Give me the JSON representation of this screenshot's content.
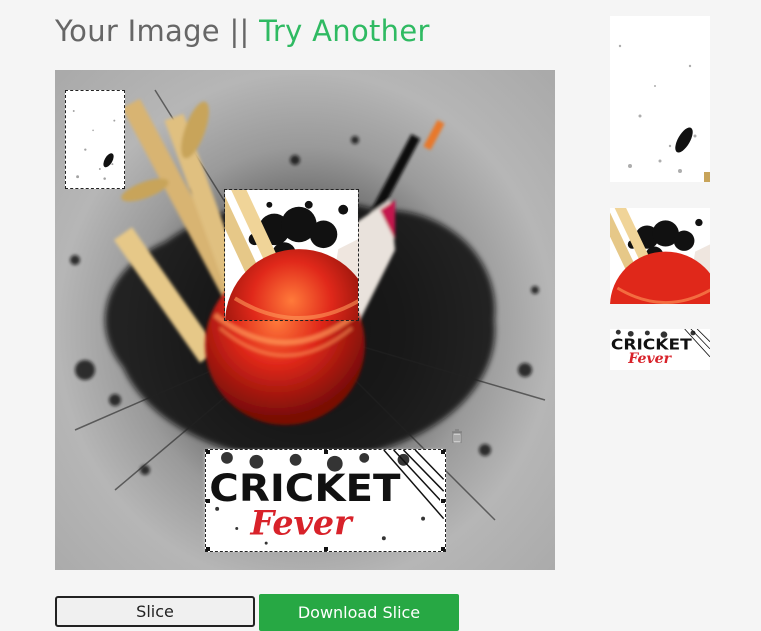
{
  "header": {
    "title": "Your Image",
    "separator": "||",
    "try_another": "Try Another"
  },
  "poster": {
    "word_top": "CRICKET",
    "word_bottom": "Fever"
  },
  "buttons": {
    "slice_label": "Slice",
    "download_label": "Download Slice"
  },
  "colors": {
    "accent_green": "#2fba62",
    "download_button": "#27a844",
    "ball_red": "#e0281a",
    "fever_red": "#d8222a"
  },
  "icons": {
    "delete": "trash-icon"
  }
}
